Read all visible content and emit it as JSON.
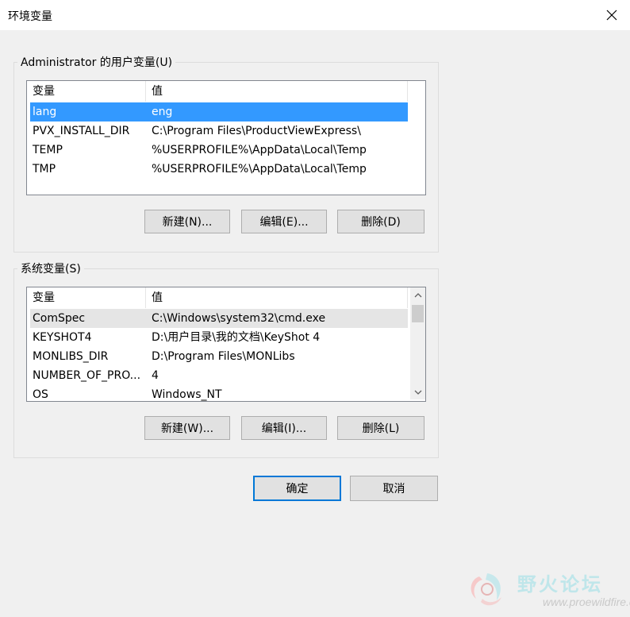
{
  "window": {
    "title": "环境变量",
    "close_icon": "close-icon"
  },
  "user_vars": {
    "group_label": "Administrator 的用户变量(U)",
    "columns": [
      "变量",
      "值"
    ],
    "rows": [
      {
        "name": "lang",
        "value": "eng",
        "selected": true
      },
      {
        "name": "PVX_INSTALL_DIR",
        "value": "C:\\Program Files\\ProductViewExpress\\"
      },
      {
        "name": "TEMP",
        "value": "%USERPROFILE%\\AppData\\Local\\Temp"
      },
      {
        "name": "TMP",
        "value": "%USERPROFILE%\\AppData\\Local\\Temp"
      }
    ],
    "buttons": {
      "new": "新建(N)...",
      "edit": "编辑(E)...",
      "delete": "删除(D)"
    }
  },
  "system_vars": {
    "group_label": "系统变量(S)",
    "columns": [
      "变量",
      "值"
    ],
    "rows": [
      {
        "name": "ComSpec",
        "value": "C:\\Windows\\system32\\cmd.exe",
        "highlighted": true
      },
      {
        "name": "KEYSHOT4",
        "value": "D:\\用户目录\\我的文档\\KeyShot 4"
      },
      {
        "name": "MONLIBS_DIR",
        "value": "D:\\Program Files\\MONLibs"
      },
      {
        "name": "NUMBER_OF_PRO...",
        "value": "4"
      },
      {
        "name": "OS",
        "value": "Windows_NT"
      }
    ],
    "buttons": {
      "new": "新建(W)...",
      "edit": "编辑(I)...",
      "delete": "删除(L)"
    }
  },
  "dialog_buttons": {
    "ok": "确定",
    "cancel": "取消"
  },
  "watermark": {
    "title": "野火论坛",
    "url": "www.proewildfire.cn"
  },
  "colors": {
    "selection": "#3399ff",
    "default_button_border": "#0078d7"
  }
}
